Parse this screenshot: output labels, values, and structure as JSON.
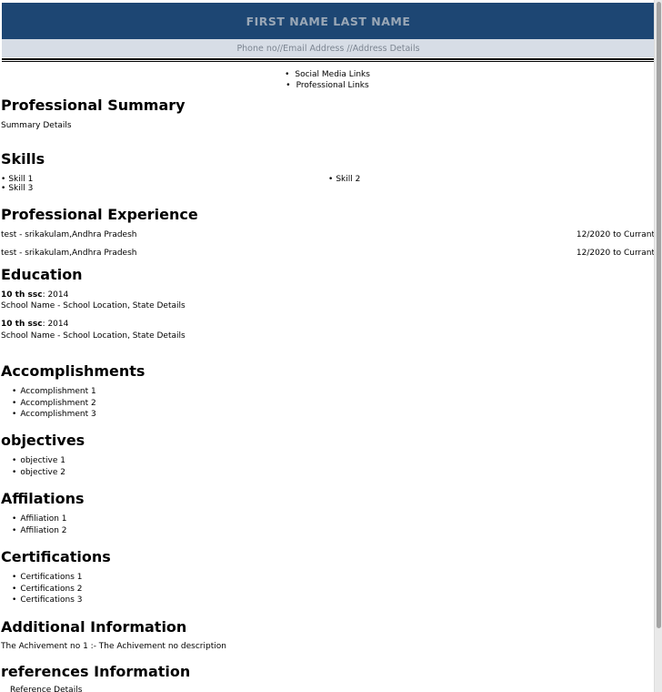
{
  "header": {
    "name": "FIRST NAME LAST NAME",
    "contact": "Phone no//Email Address //Address Details"
  },
  "links": [
    "Social Media Links",
    "Professional Links"
  ],
  "summary": {
    "heading": "Professional Summary",
    "text": "Summary Details"
  },
  "skills": {
    "heading": "Skills",
    "items": [
      "Skill 1",
      "Skill 2",
      "Skill 3"
    ]
  },
  "experience": {
    "heading": "Professional Experience",
    "items": [
      {
        "left": "test - srikakulam,Andhra Pradesh",
        "right": "12/2020 to Currant"
      },
      {
        "left": "test - srikakulam,Andhra Pradesh",
        "right": "12/2020 to Currant"
      }
    ]
  },
  "education": {
    "heading": "Education",
    "items": [
      {
        "degree": "10 th ssc",
        "year": ": 2014",
        "school": "School Name - School Location, State Details"
      },
      {
        "degree": "10 th ssc",
        "year": ": 2014",
        "school": "School Name - School Location, State Details"
      }
    ]
  },
  "accomplishments": {
    "heading": "Accomplishments",
    "items": [
      "Accomplishment 1",
      "Accomplishment 2",
      "Accomplishment 3"
    ]
  },
  "objectives": {
    "heading": "objectives",
    "items": [
      "objective 1",
      "objective 2"
    ]
  },
  "affiliations": {
    "heading": "Affilations",
    "items": [
      "Affiliation 1",
      "Affiliation 2"
    ]
  },
  "certifications": {
    "heading": "Certifications",
    "items": [
      "Certifications 1",
      "Certifications 2",
      "Certifications 3"
    ]
  },
  "additional": {
    "heading": "Additional Information",
    "text": "The Achivement no 1 :- The Achivement no description"
  },
  "references": {
    "heading": "references Information",
    "text": "Reference Details"
  },
  "colors": {
    "header_band": "#1d4673",
    "contact_band": "#d7dde6"
  }
}
